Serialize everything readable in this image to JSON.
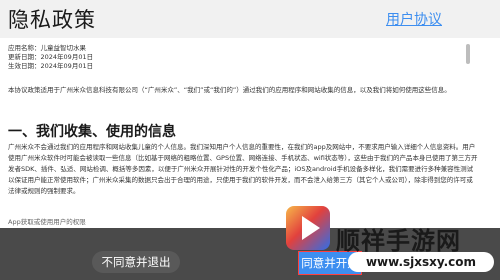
{
  "header": {
    "title": "隐私政策",
    "user_agreement_link": "用户协议"
  },
  "document": {
    "app_name_line": "应用名称：儿童益智切水果",
    "updated_line": "更新日期：2024年09月01日",
    "effective_line": "生效日期：2024年09月01日",
    "intro": "本协议政策适用于广州米众信息科技有限公司（“广州米众”、“我们”或“我们的”）通过我们的应用程序和网站收集的信息，以及我们将如何使用这些信息。",
    "section_heading": "一、我们收集、使用的信息",
    "body": "广州米众不会通过我们的应用程序和网站收集儿童的个人信息。我们深知用户个人信息的重要性，在我们的app及网站中，不要求用户输入详细个人信息资料。用户使用广州米众软件时可能会被读取一些信息（比如基于网络的粗略位置、GPS位置、网络连接、手机状态、wifi状态等），这些由于我们的产品本身已使用了第三方开发者SDK、插件、弘适、网站检调、概括等多因素，以便于广州米众开展针对性的开发个性化产品；iOS及android手机设备多样化，我们需要进行多种兼容性测试以保证用户能正常使用软件；广州米众采集的数据只会出于合理的用途，只使用于我们的软件开发，而不会泄入给第三方（其它个人或公司），除非得到您的许可或法律或规则的强制要求。",
    "cutoff": "App获取或使用用户的权限"
  },
  "buttons": {
    "disagree": "不同意并退出",
    "agree": "同意并开始"
  },
  "watermark": {
    "name": "顺祥手游网",
    "url": "www.sjxsxy.com"
  }
}
